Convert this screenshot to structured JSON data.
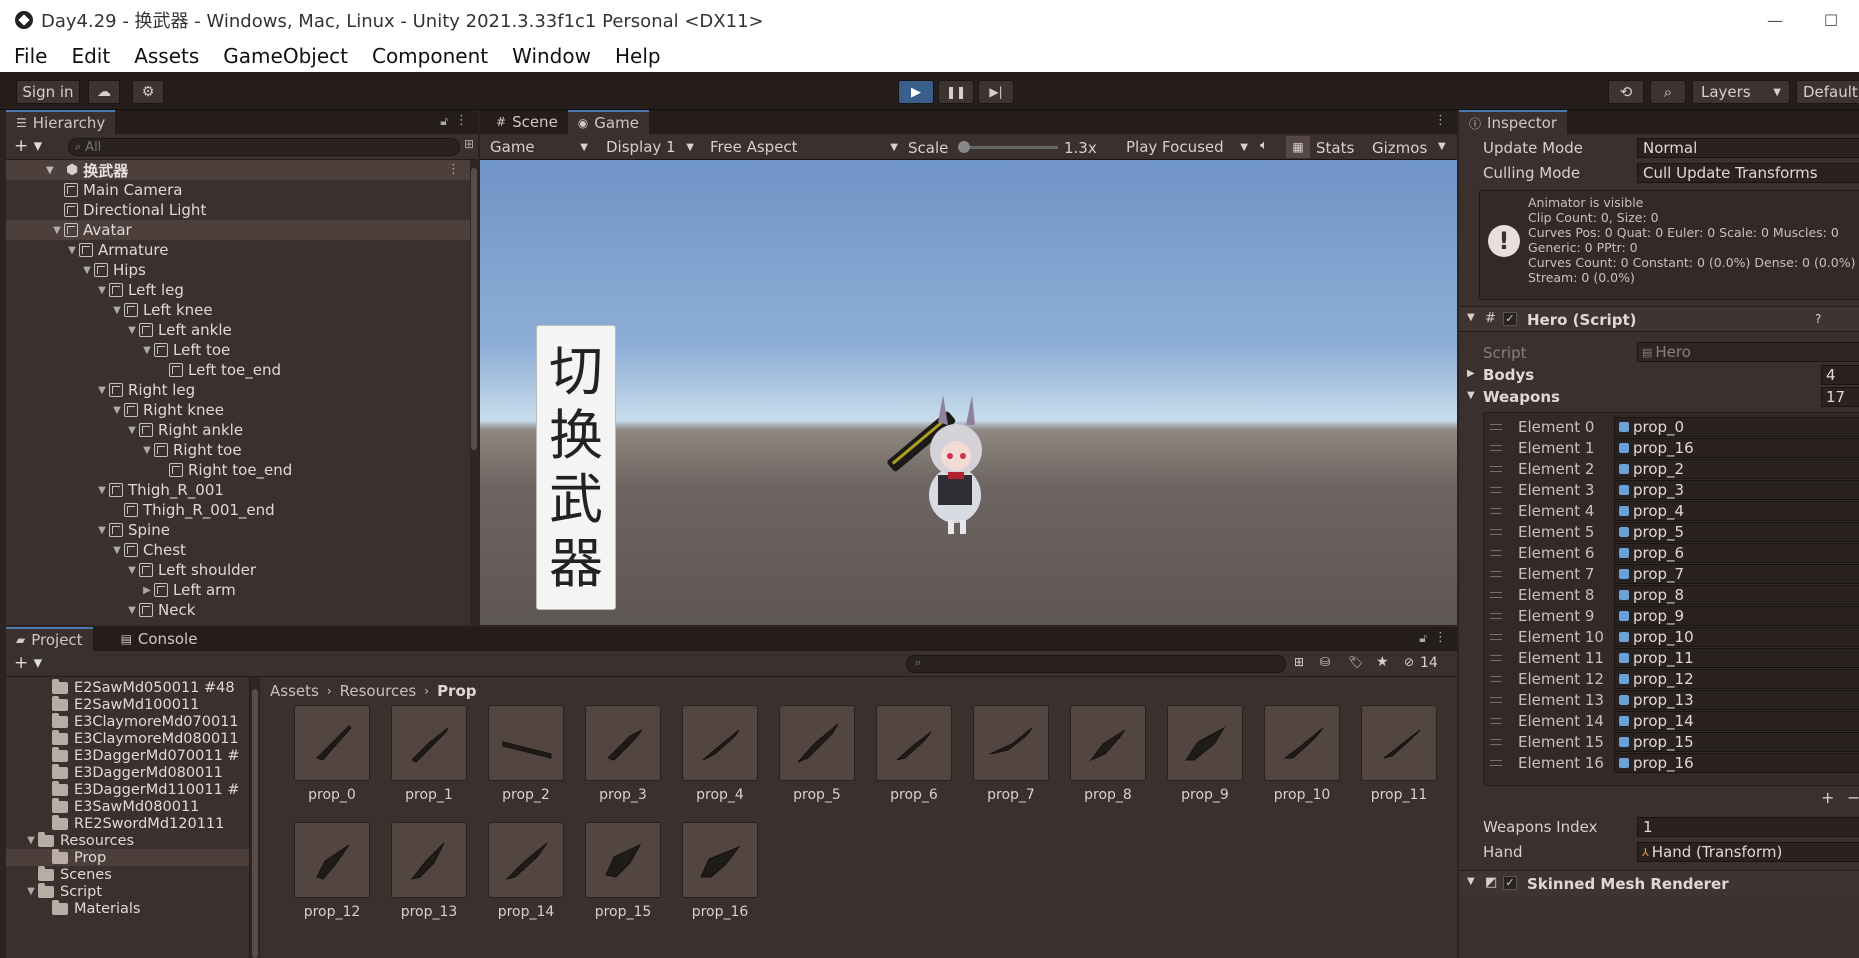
{
  "window": {
    "title": "Day4.29 - 换武器 - Windows, Mac, Linux - Unity 2021.3.33f1c1 Personal <DX11>",
    "minimize": "—",
    "maximize": "☐"
  },
  "menu": [
    "File",
    "Edit",
    "Assets",
    "GameObject",
    "Component",
    "Window",
    "Help"
  ],
  "toolbar": {
    "sign_in": "Sign in",
    "layers": "Layers",
    "layout": "Default"
  },
  "hierarchy": {
    "tab": "Hierarchy",
    "search_placeholder": "All",
    "scene": "换武器",
    "items": [
      {
        "label": "Main Camera",
        "indent": 1,
        "arrow": ""
      },
      {
        "label": "Directional Light",
        "indent": 1,
        "arrow": ""
      },
      {
        "label": "Avatar",
        "indent": 1,
        "arrow": "▼"
      },
      {
        "label": "Armature",
        "indent": 2,
        "arrow": "▼"
      },
      {
        "label": "Hips",
        "indent": 3,
        "arrow": "▼"
      },
      {
        "label": "Left leg",
        "indent": 4,
        "arrow": "▼"
      },
      {
        "label": "Left knee",
        "indent": 5,
        "arrow": "▼"
      },
      {
        "label": "Left ankle",
        "indent": 6,
        "arrow": "▼"
      },
      {
        "label": "Left toe",
        "indent": 7,
        "arrow": "▼"
      },
      {
        "label": "Left toe_end",
        "indent": 8,
        "arrow": ""
      },
      {
        "label": "Right leg",
        "indent": 4,
        "arrow": "▼"
      },
      {
        "label": "Right knee",
        "indent": 5,
        "arrow": "▼"
      },
      {
        "label": "Right ankle",
        "indent": 6,
        "arrow": "▼"
      },
      {
        "label": "Right toe",
        "indent": 7,
        "arrow": "▼"
      },
      {
        "label": "Right toe_end",
        "indent": 8,
        "arrow": ""
      },
      {
        "label": "Thigh_R_001",
        "indent": 4,
        "arrow": "▼"
      },
      {
        "label": "Thigh_R_001_end",
        "indent": 5,
        "arrow": ""
      },
      {
        "label": "Spine",
        "indent": 4,
        "arrow": "▼"
      },
      {
        "label": "Chest",
        "indent": 5,
        "arrow": "▼"
      },
      {
        "label": "Left shoulder",
        "indent": 6,
        "arrow": "▼"
      },
      {
        "label": "Left arm",
        "indent": 7,
        "arrow": "▶"
      },
      {
        "label": "Neck",
        "indent": 6,
        "arrow": "▼"
      }
    ]
  },
  "view": {
    "tabs": {
      "scene": "Scene",
      "game": "Game"
    },
    "game_dropdown": "Game",
    "display": "Display 1",
    "aspect": "Free Aspect",
    "scale_label": "Scale",
    "scale_value": "1.3x",
    "play_mode": "Play Focused",
    "stats": "Stats",
    "gizmos": "Gizmos",
    "button_text": [
      "切",
      "换",
      "武",
      "器"
    ]
  },
  "project": {
    "tabs": {
      "project": "Project",
      "console": "Console"
    },
    "hidden_count": "14",
    "breadcrumb": [
      "Assets",
      "Resources",
      "Prop"
    ],
    "tree": [
      {
        "label": "E2SawMd050011 #48",
        "indent": 2,
        "arrow": ""
      },
      {
        "label": "E2SawMd100011",
        "indent": 2,
        "arrow": ""
      },
      {
        "label": "E3ClaymoreMd070011",
        "indent": 2,
        "arrow": ""
      },
      {
        "label": "E3ClaymoreMd080011",
        "indent": 2,
        "arrow": ""
      },
      {
        "label": "E3DaggerMd070011 #",
        "indent": 2,
        "arrow": ""
      },
      {
        "label": "E3DaggerMd080011",
        "indent": 2,
        "arrow": ""
      },
      {
        "label": "E3DaggerMd110011 #",
        "indent": 2,
        "arrow": ""
      },
      {
        "label": "E3SawMd080011",
        "indent": 2,
        "arrow": ""
      },
      {
        "label": "RE2SwordMd120111",
        "indent": 2,
        "arrow": ""
      },
      {
        "label": "Resources",
        "indent": 1,
        "arrow": "▼"
      },
      {
        "label": "Prop",
        "indent": 2,
        "arrow": ""
      },
      {
        "label": "Scenes",
        "indent": 1,
        "arrow": ""
      },
      {
        "label": "Script",
        "indent": 1,
        "arrow": "▼"
      },
      {
        "label": "Materials",
        "indent": 2,
        "arrow": ""
      }
    ],
    "assets": [
      "prop_0",
      "prop_1",
      "prop_2",
      "prop_3",
      "prop_4",
      "prop_5",
      "prop_6",
      "prop_7",
      "prop_8",
      "prop_9",
      "prop_10",
      "prop_11",
      "prop_12",
      "prop_13",
      "prop_14",
      "prop_15",
      "prop_16"
    ]
  },
  "inspector": {
    "tab": "Inspector",
    "update_mode_label": "Update Mode",
    "update_mode": "Normal",
    "culling_mode_label": "Culling Mode",
    "culling_mode": "Cull Update Transforms",
    "info_lines": [
      "Animator is visible",
      "Clip Count: 0, Size: 0",
      "Curves Pos: 0 Quat: 0 Euler: 0 Scale: 0 Muscles: 0",
      "Generic: 0 PPtr: 0",
      "Curves Count: 0 Constant: 0 (0.0%) Dense: 0 (0.0%)",
      "Stream: 0 (0.0%)"
    ],
    "component": "Hero (Script)",
    "script_label": "Script",
    "script_value": "Hero",
    "bodys_label": "Bodys",
    "bodys_count": "4",
    "weapons_label": "Weapons",
    "weapons_count": "17",
    "elements": [
      {
        "label": "Element 0",
        "value": "prop_0"
      },
      {
        "label": "Element 1",
        "value": "prop_16"
      },
      {
        "label": "Element 2",
        "value": "prop_2"
      },
      {
        "label": "Element 3",
        "value": "prop_3"
      },
      {
        "label": "Element 4",
        "value": "prop_4"
      },
      {
        "label": "Element 5",
        "value": "prop_5"
      },
      {
        "label": "Element 6",
        "value": "prop_6"
      },
      {
        "label": "Element 7",
        "value": "prop_7"
      },
      {
        "label": "Element 8",
        "value": "prop_8"
      },
      {
        "label": "Element 9",
        "value": "prop_9"
      },
      {
        "label": "Element 10",
        "value": "prop_10"
      },
      {
        "label": "Element 11",
        "value": "prop_11"
      },
      {
        "label": "Element 12",
        "value": "prop_12"
      },
      {
        "label": "Element 13",
        "value": "prop_13"
      },
      {
        "label": "Element 14",
        "value": "prop_14"
      },
      {
        "label": "Element 15",
        "value": "prop_15"
      },
      {
        "label": "Element 16",
        "value": "prop_16"
      }
    ],
    "weapons_index_label": "Weapons Index",
    "weapons_index": "1",
    "hand_label": "Hand",
    "hand_value": "Hand (Transform)",
    "next_component": "Skinned Mesh Renderer"
  },
  "colors": {
    "accent": "#4a7ab0",
    "play_active": "#3a5f8a",
    "selected_row": "#4d403c"
  }
}
